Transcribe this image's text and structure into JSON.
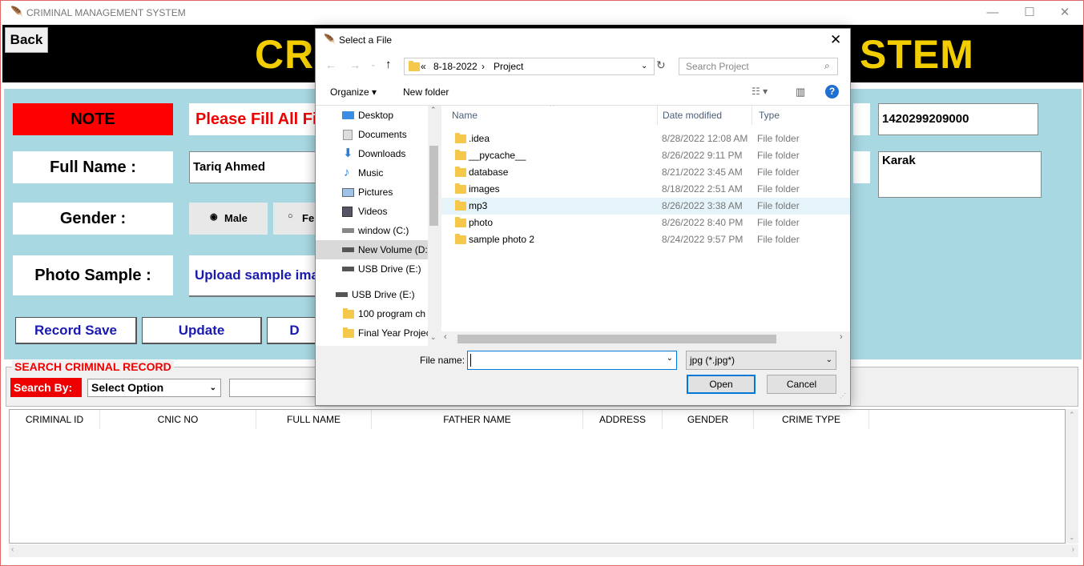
{
  "window": {
    "title": "CRIMINAL MANAGEMENT SYSTEM",
    "controls": {
      "minimize": "—",
      "maximize": "☐",
      "close": "✕"
    }
  },
  "header": {
    "back_label": "Back",
    "title_left": "CR",
    "title_right": "STEM"
  },
  "form": {
    "note_label": "NOTE",
    "note_text": "Please Fill All Fie",
    "full_name_label": "Full Name :",
    "full_name_value": "Tariq Ahmed",
    "gender_label": "Gender :",
    "gender_male": "Male",
    "gender_female": "Fer",
    "photo_label": "Photo Sample :",
    "upload_text": "Upload sample imag",
    "cnic_value": "1420299209000",
    "address_value": "Karak",
    "buttons": {
      "save": "Record Save",
      "update": "Update",
      "delete": "D"
    }
  },
  "search": {
    "legend": "SEARCH CRIMINAL RECORD",
    "search_by_label": "Search By:",
    "select_value": "Select Option",
    "input_value": ""
  },
  "table": {
    "columns": [
      "CRIMINAL ID",
      "CNIC NO",
      "FULL NAME",
      "FATHER NAME",
      "ADDRESS",
      "GENDER",
      "CRIME TYPE"
    ]
  },
  "dialog": {
    "title": "Select a File",
    "path": [
      "«",
      "8-18-2022",
      "›",
      "Project"
    ],
    "search_placeholder": "Search Project",
    "organize_label": "Organize ▾",
    "new_folder_label": "New folder",
    "tree": [
      {
        "label": "Desktop",
        "icon": "desktop-icon"
      },
      {
        "label": "Documents",
        "icon": "documents-icon"
      },
      {
        "label": "Downloads",
        "icon": "downloads-icon"
      },
      {
        "label": "Music",
        "icon": "music-icon"
      },
      {
        "label": "Pictures",
        "icon": "pictures-icon"
      },
      {
        "label": "Videos",
        "icon": "videos-icon"
      },
      {
        "label": "window (C:)",
        "icon": "drive-icon"
      },
      {
        "label": "New Volume (D:)",
        "icon": "drive-icon",
        "selected": true
      },
      {
        "label": "USB Drive (E:)",
        "icon": "usb-drive-icon"
      },
      {
        "label": "USB Drive (E:)",
        "icon": "usb-drive-icon"
      },
      {
        "label": "100  program ch",
        "icon": "folder-icon"
      },
      {
        "label": "Final Year Projec",
        "icon": "folder-icon"
      }
    ],
    "columns": {
      "name": "Name",
      "date": "Date modified",
      "type": "Type"
    },
    "files": [
      {
        "name": ".idea",
        "date": "8/28/2022 12:08 AM",
        "type": "File folder"
      },
      {
        "name": "__pycache__",
        "date": "8/26/2022 9:11 PM",
        "type": "File folder"
      },
      {
        "name": "database",
        "date": "8/21/2022 3:45 AM",
        "type": "File folder"
      },
      {
        "name": "images",
        "date": "8/18/2022 2:51 AM",
        "type": "File folder"
      },
      {
        "name": "mp3",
        "date": "8/26/2022 3:38 AM",
        "type": "File folder",
        "hover": true
      },
      {
        "name": "photo",
        "date": "8/26/2022 8:40 PM",
        "type": "File folder"
      },
      {
        "name": "sample photo 2",
        "date": "8/24/2022 9:57 PM",
        "type": "File folder"
      }
    ],
    "file_name_label": "File name:",
    "file_name_value": "",
    "file_type": "jpg (*.jpg*)",
    "open_label": "Open",
    "cancel_label": "Cancel"
  },
  "colors": {
    "header_bg": "#000000",
    "title_yellow": "#f2cd00",
    "form_bg": "#a8d8e2",
    "note_red": "#ff0000",
    "button_blue": "#1a1ab0"
  }
}
